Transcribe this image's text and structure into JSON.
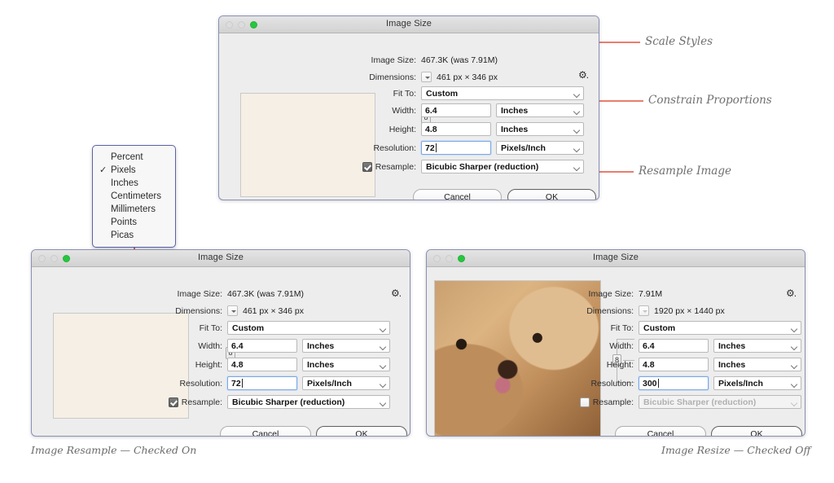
{
  "dialogs": {
    "top": {
      "title": "Image Size",
      "image_size_label": "Image Size:",
      "image_size_value": "467.3K (was 7.91M)",
      "dimensions_label": "Dimensions:",
      "dimensions_value": "461 px  ×  346 px",
      "fit_to_label": "Fit To:",
      "fit_to_value": "Custom",
      "width_label": "Width:",
      "width_value": "6.4",
      "width_unit": "Inches",
      "height_label": "Height:",
      "height_value": "4.8",
      "height_unit": "Inches",
      "resolution_label": "Resolution:",
      "resolution_value": "72",
      "resolution_unit": "Pixels/Inch",
      "resample_label": "Resample:",
      "resample_value": "Bicubic Sharper (reduction)",
      "resample_checked": "checked",
      "cancel_label": "Cancel",
      "ok_label": "OK",
      "gear_glyph": "⚙."
    },
    "bottom_left": {
      "title": "Image Size",
      "image_size_label": "Image Size:",
      "image_size_value": "467.3K (was 7.91M)",
      "dimensions_label": "Dimensions:",
      "dimensions_value": "461 px  ×  346 px",
      "fit_to_label": "Fit To:",
      "fit_to_value": "Custom",
      "width_label": "Width:",
      "width_value": "6.4",
      "width_unit": "Inches",
      "height_label": "Height:",
      "height_value": "4.8",
      "height_unit": "Inches",
      "resolution_label": "Resolution:",
      "resolution_value": "72",
      "resolution_unit": "Pixels/Inch",
      "resample_label": "Resample:",
      "resample_value": "Bicubic Sharper (reduction)",
      "resample_checked": "checked",
      "cancel_label": "Cancel",
      "ok_label": "OK",
      "gear_glyph": "⚙."
    },
    "bottom_right": {
      "title": "Image Size",
      "image_size_label": "Image Size:",
      "image_size_value": "7.91M",
      "dimensions_label": "Dimensions:",
      "dimensions_value": "1920 px  ×  1440 px",
      "fit_to_label": "Fit To:",
      "fit_to_value": "Custom",
      "width_label": "Width:",
      "width_value": "6.4",
      "width_unit": "Inches",
      "height_label": "Height:",
      "height_value": "4.8",
      "height_unit": "Inches",
      "resolution_label": "Resolution:",
      "resolution_value": "300",
      "resolution_unit": "Pixels/Inch",
      "resample_label": "Resample:",
      "resample_value": "Bicubic Sharper (reduction)",
      "resample_checked": "unchecked",
      "cancel_label": "Cancel",
      "ok_label": "OK",
      "gear_glyph": "⚙."
    }
  },
  "units_menu": {
    "checkmark": "✓",
    "items": [
      {
        "label": "Percent",
        "selected": false
      },
      {
        "label": "Pixels",
        "selected": true
      },
      {
        "label": "Inches",
        "selected": false
      },
      {
        "label": "Centimeters",
        "selected": false
      },
      {
        "label": "Millimeters",
        "selected": false
      },
      {
        "label": "Points",
        "selected": false
      },
      {
        "label": "Picas",
        "selected": false
      }
    ]
  },
  "annotations": {
    "scale_styles": "Scale Styles",
    "constrain_proportions": "Constrain Proportions",
    "resample_image": "Resample Image"
  },
  "captions": {
    "left": "Image Resample — Checked On",
    "right": "Image Resize — Checked Off"
  },
  "colors": {
    "annotation_red": "#e0543f",
    "dialog_bg": "#ededed",
    "dialog_border": "#8a90b8",
    "text": "#2e2e2e"
  }
}
